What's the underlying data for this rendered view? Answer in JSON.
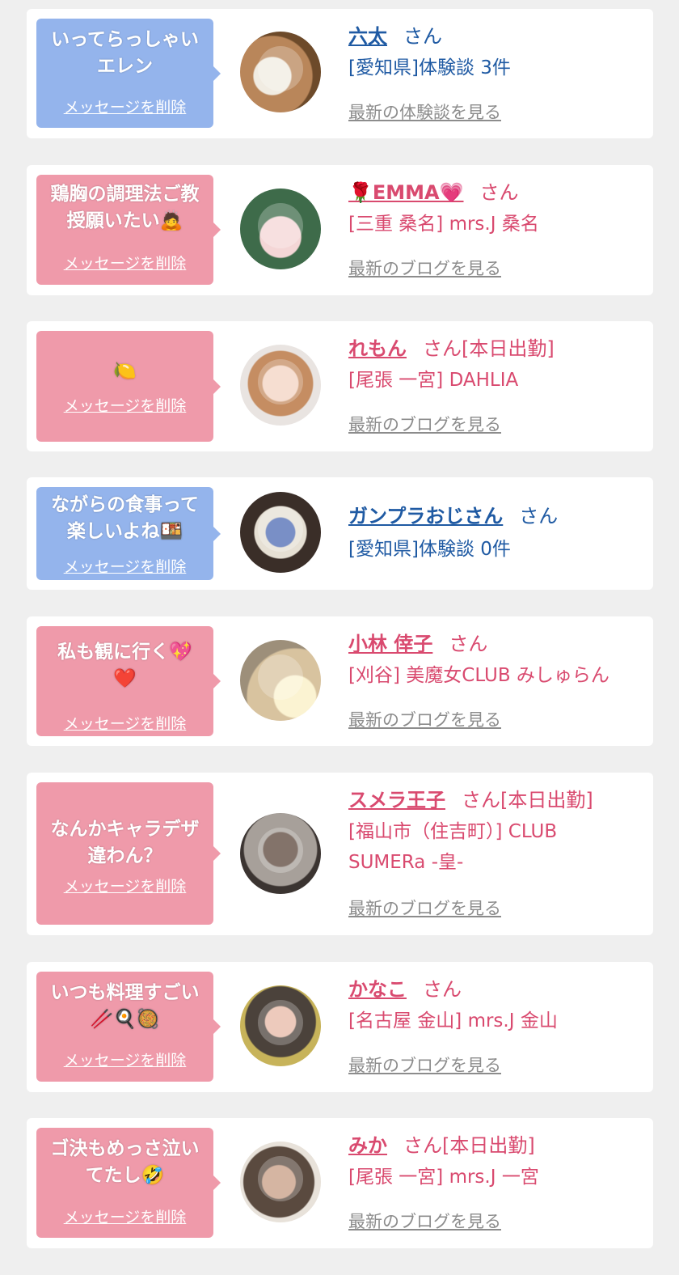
{
  "delete_label": "メッセージを削除",
  "honorific": "さん",
  "items": [
    {
      "type": "review",
      "message": "いってらっしゃい\nエレン",
      "name": "六太",
      "status": "",
      "sub": "[愛知県]体験談 3件",
      "link": "最新の体験談を見る",
      "avatar_icon": "plate-food-photo"
    },
    {
      "type": "blog",
      "message": "鶏胸の調理法ご教\n授願いたい🙇",
      "name": "🌹EMMA💗",
      "status": "",
      "sub": "[三重 桑名] mrs.J 桑名",
      "link": "最新のブログを見る",
      "avatar_icon": "girl-selfie-photo"
    },
    {
      "type": "blog",
      "message": "🍋",
      "name": "れもん",
      "status": "[本日出勤]",
      "sub": "[尾張 一宮] DAHLIA",
      "link": "最新のブログを見る",
      "avatar_icon": "girl-portrait-photo"
    },
    {
      "type": "review",
      "message": "ながらの食事って\n楽しいよね🍱",
      "name": "ガンプラおじさん",
      "status": "",
      "sub": "[愛知県]体験談 0件",
      "link": "",
      "avatar_icon": "robot-model-photo"
    },
    {
      "type": "blog",
      "message": "私も観に行く💖\n❤️",
      "name": "小林 倖子",
      "status": "",
      "sub": "[刈谷] 美魔女CLUB みしゅらん",
      "link": "最新のブログを見る",
      "avatar_icon": "flower-face-photo"
    },
    {
      "type": "blog",
      "message": "なんかキャラデザ\n違わん？",
      "name": "スメラ王子",
      "status": "[本日出勤]",
      "sub": "[福山市（住吉町）] CLUB\nSUMERa -皇-",
      "link": "最新のブログを見る",
      "avatar_icon": "costume-man-photo"
    },
    {
      "type": "blog",
      "message": "いつも料理すごい\n🥢🍳🥘",
      "name": "かなこ",
      "status": "",
      "sub": "[名古屋 金山] mrs.J 金山",
      "link": "最新のブログを見る",
      "avatar_icon": "woman-dress-photo"
    },
    {
      "type": "blog",
      "message": "ゴ決もめっさ泣い\nてたし🤣",
      "name": "みか",
      "status": "[本日出勤]",
      "sub": "[尾張 一宮] mrs.J 一宮",
      "link": "最新のブログを見る",
      "avatar_icon": "woman-cat-photo"
    }
  ],
  "colors": {
    "blue_bubble": "#94b4ec",
    "pink_bubble": "#ef9aaa",
    "blue_text": "#1f5aa3",
    "pink_text": "#d94a6f",
    "link_gray": "#8c8c8c",
    "background": "#efefef"
  }
}
